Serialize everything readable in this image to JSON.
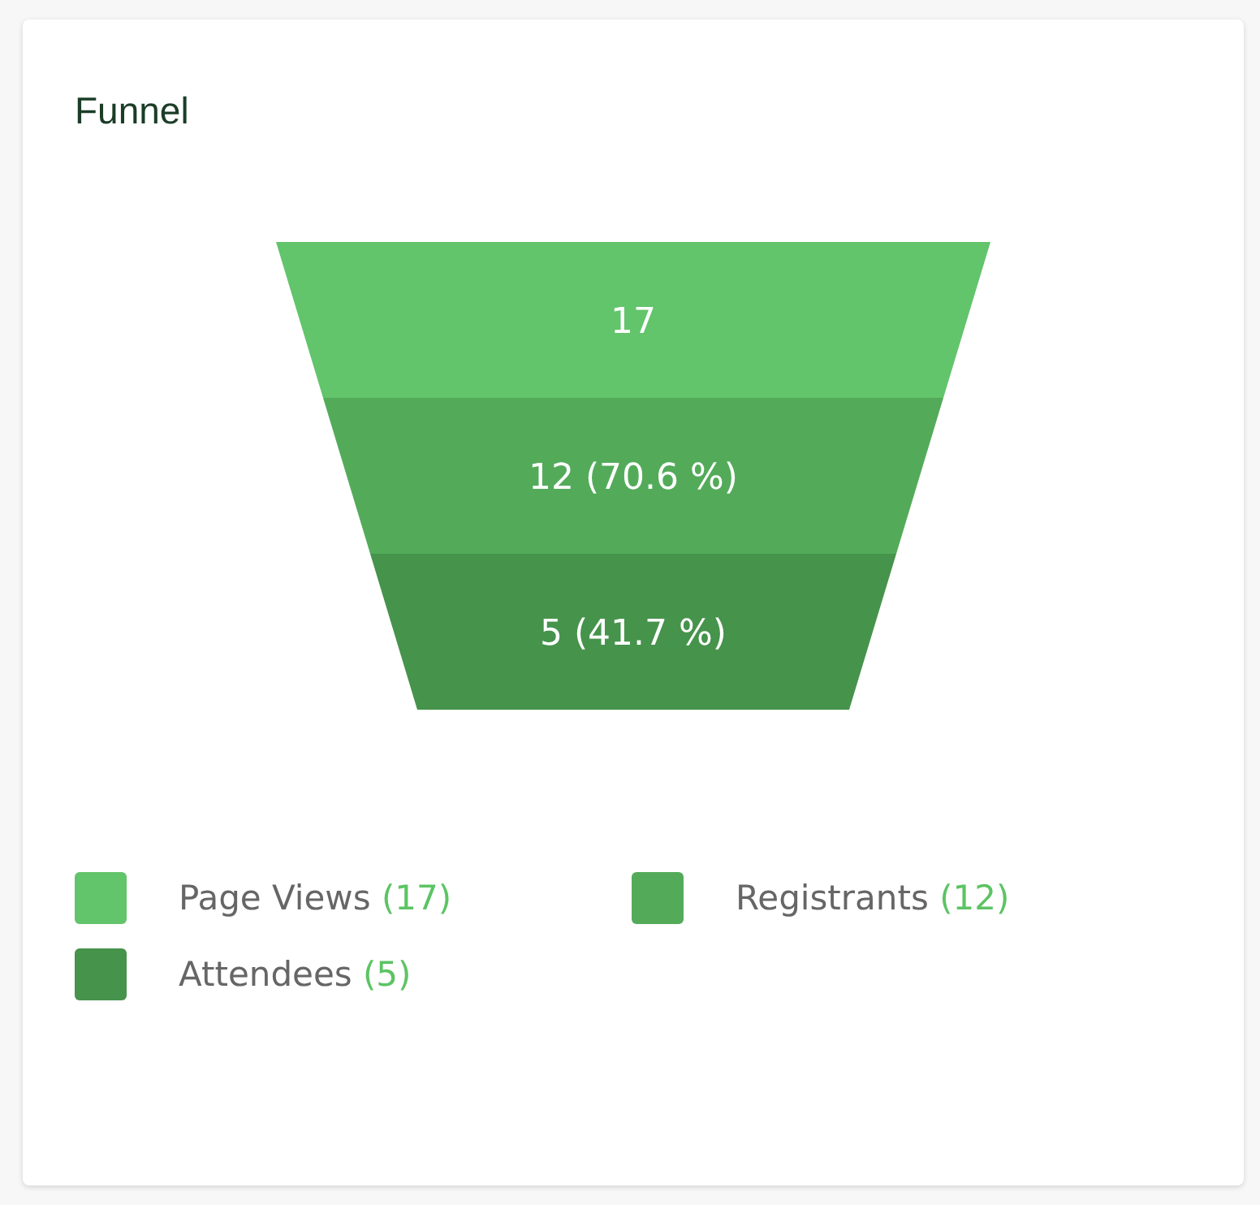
{
  "card": {
    "title": "Funnel"
  },
  "funnel": {
    "stages": [
      {
        "label": "17",
        "color": "#62c46b"
      },
      {
        "label": "12 (70.6 %)",
        "color": "#53ab5a"
      },
      {
        "label": "5 (41.7 %)",
        "color": "#46934b"
      }
    ]
  },
  "legend": [
    {
      "name": "Page Views",
      "count": "(17)",
      "color": "#62c46b"
    },
    {
      "name": "Registrants",
      "count": "(12)",
      "color": "#53ab5a"
    },
    {
      "name": "Attendees",
      "count": "(5)",
      "color": "#46934b"
    }
  ]
}
